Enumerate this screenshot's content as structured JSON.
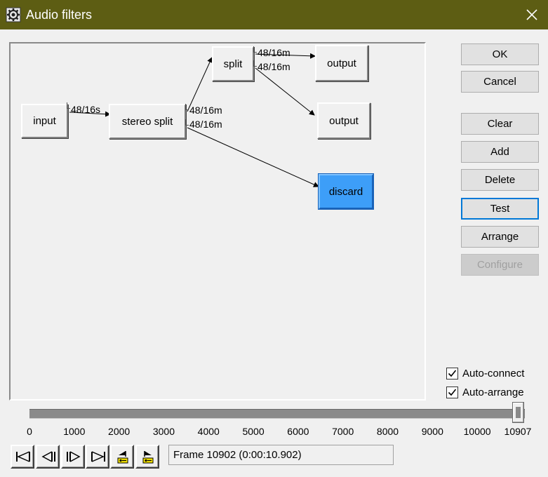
{
  "window": {
    "title": "Audio filters",
    "titlebar_color": "#5d5d13",
    "icon": "gear-icon",
    "close_icon": "close-icon"
  },
  "graph": {
    "nodes": {
      "input": "input",
      "stereo_split": "stereo split",
      "split": "split",
      "output1": "output",
      "output2": "output",
      "discard": "discard"
    },
    "pins": {
      "input_out": "48/16s",
      "stereo_out1": "48/16m",
      "stereo_out2": "48/16m",
      "split_out1": "48/16m",
      "split_out2": "48/16m"
    },
    "selected_node": "discard",
    "selected_color": "#3d9ef8"
  },
  "buttons": {
    "ok": "OK",
    "cancel": "Cancel",
    "clear": "Clear",
    "add": "Add",
    "delete": "Delete",
    "test": "Test",
    "arrange": "Arrange",
    "configure": "Configure"
  },
  "options": {
    "auto_connect": {
      "label": "Auto-connect",
      "checked": true
    },
    "auto_arrange": {
      "label": "Auto-arrange",
      "checked": true
    }
  },
  "timeline": {
    "ticks": [
      "0",
      "1000",
      "2000",
      "3000",
      "4000",
      "5000",
      "6000",
      "7000",
      "8000",
      "9000",
      "10000",
      "10907"
    ],
    "min": 0,
    "max": 10907,
    "current_frame": 10902
  },
  "transport": {
    "buttons": [
      "go-to-start-icon",
      "step-back-icon",
      "step-forward-icon",
      "go-to-end-icon",
      "prev-keyframe-icon",
      "next-keyframe-icon"
    ]
  },
  "status": {
    "frame_text": "Frame 10902 (0:00:10.902)"
  }
}
